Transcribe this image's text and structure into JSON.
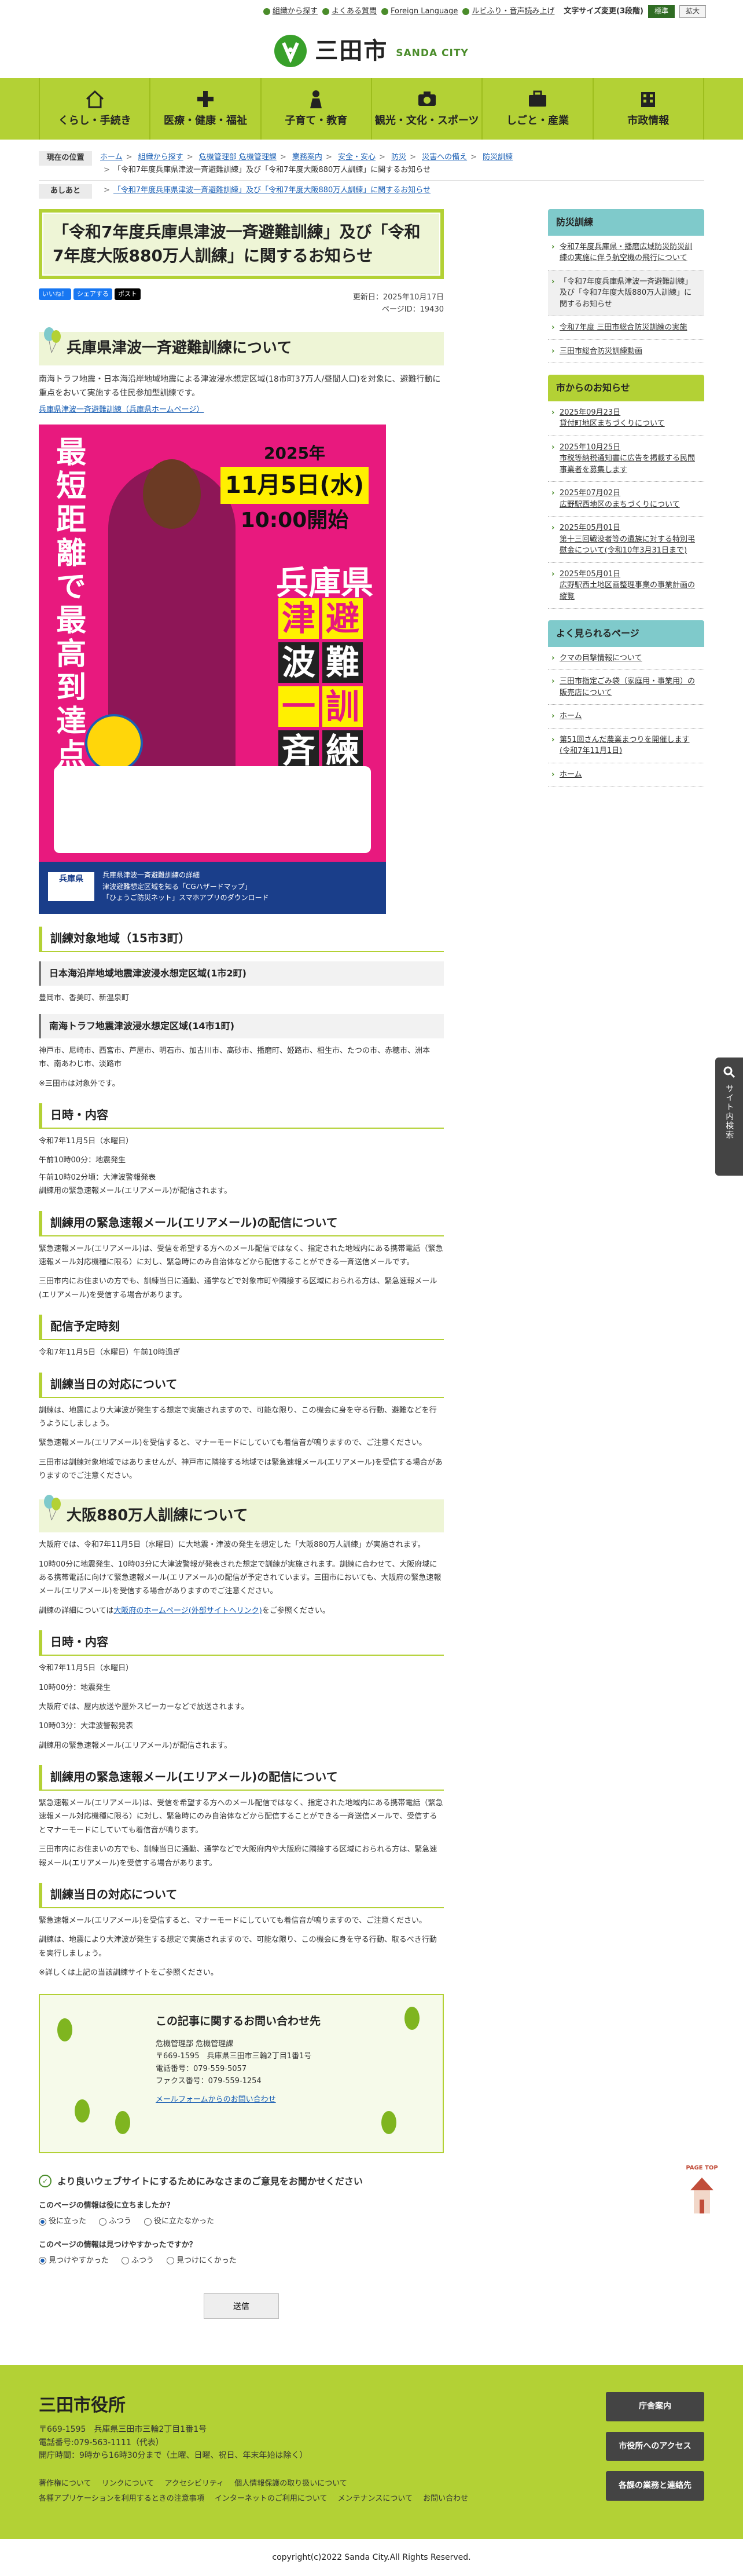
{
  "utility": {
    "links": [
      "組織から探す",
      "よくある質問",
      "Foreign Language",
      "ルビふり・音声読み上げ"
    ],
    "font_size_label": "文字サイズ変更(3段階)",
    "font_sizes": [
      "標準",
      "拡大"
    ]
  },
  "logo": {
    "text": "三田市",
    "sub": "SANDA CITY"
  },
  "gnav": [
    {
      "label": "くらし・手続き",
      "icon": "house-icon"
    },
    {
      "label": "医療・健康・福祉",
      "icon": "cross-icon"
    },
    {
      "label": "子育て・教育",
      "icon": "child-icon"
    },
    {
      "label": "観光・文化・スポーツ",
      "icon": "camera-icon"
    },
    {
      "label": "しごと・産業",
      "icon": "briefcase-icon"
    },
    {
      "label": "市政情報",
      "icon": "building-icon"
    }
  ],
  "breadcrumbs": {
    "current_label": "現在の位置",
    "current_path": [
      "ホーム",
      "組織から探す",
      "危機管理部 危機管理課",
      "業務案内",
      "安全・安心",
      "防災",
      "災害への備え",
      "防災訓練"
    ],
    "current_tail": "「令和7年度兵庫県津波一斉避難訓練」及び「令和7年度大阪880万人訓練」に関するお知らせ",
    "trail_label": "あしあと",
    "trail_text": "「令和7年度兵庫県津波一斉避難訓練」及び「令和7年度大阪880万人訓練」に関するお知らせ"
  },
  "page": {
    "title": "「令和7年度兵庫県津波一斉避難訓練」及び「令和7年度大阪880万人訓練」に関するお知らせ",
    "social": [
      "いいね！",
      "シェアする",
      "ポスト"
    ],
    "updated": "更新日：2025年10月17日",
    "page_id": "ページID：19430"
  },
  "hyogo": {
    "heading": "兵庫県津波一斉避難訓練について",
    "lead": "南海トラフ地震・日本海沿岸地域地震による津波浸水想定区域(18市町37万人/昼間人口)を対象に、避難行動に重点をおいて実施する住民参加型訓練です。",
    "link": "兵庫県津波一斉避難訓練（兵庫県ホームページ）",
    "poster": {
      "left": "最短距離で最高到達点へ",
      "year": "2025年",
      "date": "11月5日(水)",
      "time": "10:00開始",
      "pref": "兵庫県",
      "chars": [
        "津",
        "避",
        "波",
        "難",
        "一",
        "訓",
        "斉",
        "練"
      ],
      "footer_logo": "兵庫県",
      "footer1": "兵庫県津波一斉避難訓練の詳細",
      "footer2": "津波避難想定区域を知る「CGハザードマップ」",
      "footer3": "「ひょうご防災ネット」スマホアプリのダウンロード"
    },
    "area_heading": "訓練対象地域（15市3町）",
    "japan_sea_heading": "日本海沿岸地域地震津波浸水想定区域(1市2町)",
    "japan_sea_text": "豊岡市、香美町、新温泉町",
    "nankai_heading": "南海トラフ地震津波浸水想定区域(14市1町)",
    "nankai_text": "神戸市、尼崎市、西宮市、芦屋市、明石市、加古川市、高砂市、播磨町、姫路市、相生市、たつの市、赤穂市、洲本市、南あわじ市、淡路市",
    "nankai_note": "※三田市は対象外です。",
    "schedule_heading": "日時・内容",
    "schedule": [
      "令和7年11月5日（水曜日）",
      "午前10時00分：地震発生",
      "午前10時02分頃：大津波警報発表",
      "訓練用の緊急速報メール(エリアメール)が配信されます。"
    ],
    "mail_heading": "訓練用の緊急速報メール(エリアメール)の配信について",
    "mail_text1": "緊急速報メール(エリアメール)は、受信を希望する方へのメール配信ではなく、指定された地域内にある携帯電話（緊急速報メール対応機種に限る）に対し、緊急時にのみ自治体などから配信することができる一斉送信メールです。",
    "mail_text2": "三田市内にお住まいの方でも、訓練当日に通勤、通学などで対象市町や隣接する区域におられる方は、緊急速報メール(エリアメール)を受信する場合があります。",
    "delivery_heading": "配信予定時刻",
    "delivery_text": "令和7年11月5日（水曜日）午前10時過ぎ",
    "day_heading": "訓練当日の対応について",
    "day_text1": "訓練は、地震により大津波が発生する想定で実施されますので、可能な限り、この機会に身を守る行動、避難などを行うようにしましょう。",
    "day_text2": "緊急速報メール(エリアメール)を受信すると、マナーモードにしていても着信音が鳴りますので、ご注意ください。",
    "day_text3": "三田市は訓練対象地域ではありませんが、神戸市に隣接する地域では緊急速報メール(エリアメール)を受信する場合がありますのでご注意ください。"
  },
  "osaka": {
    "heading": "大阪880万人訓練について",
    "p1": "大阪府では、令和7年11月5日（水曜日）に大地震・津波の発生を想定した「大阪880万人訓練」が実施されます。",
    "p2": "10時00分に地震発生、10時03分に大津波警報が発表された想定で訓練が実施されます。訓練に合わせて、大阪府域にある携帯電話に向けて緊急速報メール(エリアメール)の配信が予定されています。三田市においても、大阪府の緊急速報メール(エリアメール)を受信する場合がありますのでご注意ください。",
    "p3_prefix": "訓練の詳細については",
    "p3_link": "大阪府のホームページ(外部サイトへリンク)",
    "p3_suffix": "をご参照ください。",
    "schedule_heading": "日時・内容",
    "schedule": [
      "令和7年11月5日（水曜日）",
      "10時00分：地震発生",
      "大阪府では、屋内放送や屋外スピーカーなどで放送されます。",
      "10時03分：大津波警報発表",
      "訓練用の緊急速報メール(エリアメール)が配信されます。"
    ],
    "mail_heading": "訓練用の緊急速報メール(エリアメール)の配信について",
    "mail_text1": "緊急速報メール(エリアメール)は、受信を希望する方へのメール配信ではなく、指定された地域内にある携帯電話（緊急速報メール対応機種に限る）に対し、緊急時にのみ自治体などから配信することができる一斉送信メールで、受信するとマナーモードにしていても着信音が鳴ります。",
    "mail_text2": "三田市内にお住まいの方でも、訓練当日に通勤、通学などで大阪府内や大阪府に隣接する区域におられる方は、緊急速報メール(エリアメール)を受信する場合があります。",
    "day_heading": "訓練当日の対応について",
    "day_text1": "緊急速報メール(エリアメール)を受信すると、マナーモードにしていても着信音が鳴りますので、ご注意ください。",
    "day_text2": "訓練は、地震により大津波が発生する想定で実施されますので、可能な限り、この機会に身を守る行動、取るべき行動を実行しましょう。",
    "day_text3": "※詳しくは上記の当該訓練サイトをご参照ください。"
  },
  "contact": {
    "heading": "この記事に関するお問い合わせ先",
    "lines": [
      "危機管理部 危機管理課",
      "〒669-1595　兵庫県三田市三輪2丁目1番1号",
      "電話番号：079-559-5057",
      "ファクス番号：079-559-1254"
    ],
    "form_link": "メールフォームからのお問い合わせ"
  },
  "survey": {
    "title": "より良いウェブサイトにするためにみなさまのご意見をお聞かせください",
    "q1": "このページの情報は役に立ちましたか？",
    "q1_options": [
      "役に立った",
      "ふつう",
      "役に立たなかった"
    ],
    "q2": "このページの情報は見つけやすかったですか？",
    "q2_options": [
      "見つけやすかった",
      "ふつう",
      "見つけにくかった"
    ],
    "submit": "送信"
  },
  "sidebar": {
    "box1_title": "防災訓練",
    "box1_items": [
      "令和7年度兵庫県・播磨広域防災防災訓練の実施に伴う航空機の飛行について",
      "「令和7年度兵庫県津波一斉避難訓練」及び「令和7年度大阪880万人訓練」に関するお知らせ",
      "令和7年度 三田市総合防災訓練の実施",
      "三田市総合防災訓練動画"
    ],
    "box2_title": "市からのお知らせ",
    "box2_items": [
      "2025年09月23日\n貸付町地区まちづくりについて",
      "2025年10月25日\n市税等納税通知書に広告を掲載する民間事業者を募集します",
      "2025年07月02日\n広野駅西地区のまちづくりについて",
      "2025年05月01日\n第十三回戦没者等の遺族に対する特別弔慰金について(令和10年3月31日まで)",
      "2025年05月01日\n広野駅西土地区画整理事業の事業計画の縦覧"
    ],
    "box3_title": "よく見られるページ",
    "box3_items": [
      "クマの目撃情報について",
      "三田市指定ごみ袋（家庭用・事業用）の販売店について",
      "ホーム",
      "第51回さんだ農業まつりを開催します(令和7年11月1日)",
      "ホーム"
    ]
  },
  "float_tab": "サイト内検索",
  "pagetop": "PAGE TOP",
  "footer": {
    "org": "三田市役所",
    "addr1": "〒669-1595　兵庫県三田市三輪2丁目1番1号",
    "addr2": "電話番号:079-563-1111（代表）",
    "addr3": "開庁時間：9時から16時30分まで（土曜、日曜、祝日、年末年始は除く）",
    "links1": [
      "著作権について",
      "リンクについて",
      "アクセシビリティ",
      "個人情報保護の取り扱いについて"
    ],
    "links2": [
      "各種アプリケーションを利用するときの注意事項",
      "インターネットのご利用について",
      "メンテナンスについて",
      "お問い合わせ"
    ],
    "buttons": [
      "庁舎案内",
      "市役所へのアクセス",
      "各課の業務と連絡先"
    ],
    "copyright": "copyright(c)2022 Sanda City.All Rights Reserved."
  }
}
